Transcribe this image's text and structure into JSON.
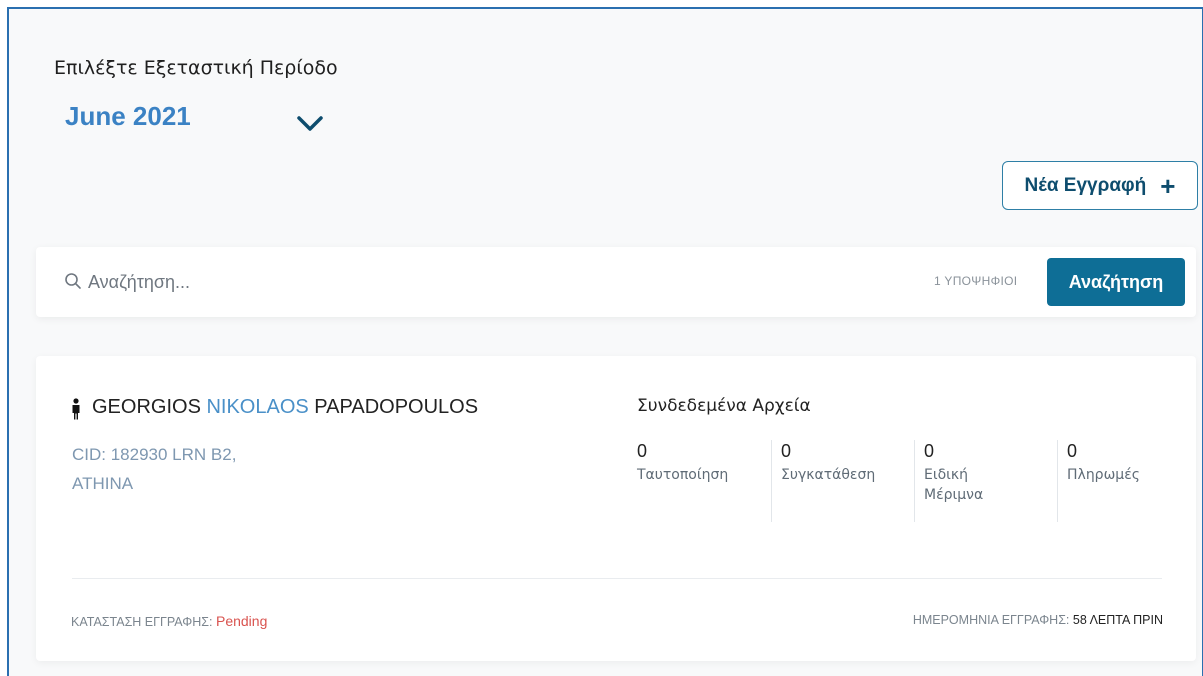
{
  "period": {
    "label": "Επιλέξτε Εξεταστική Περίοδο",
    "selected": "June 2021"
  },
  "new_registration_label": "Νέα Εγγραφή",
  "search": {
    "placeholder": "Αναζήτηση...",
    "candidates_count": "1 ΥΠΟΨΗΦΙΟΙ",
    "button_label": "Αναζήτηση"
  },
  "candidate": {
    "first_name": "GEORGIOS",
    "middle_name": "NIKOLAOS",
    "last_name": "PAPADOPOULOS",
    "cid_line": "CID: 182930 LRN B2,",
    "city": "ATHINA",
    "files_title": "Συνδεδεμένα Αρχεία",
    "files": [
      {
        "count": "0",
        "label": "Ταυτοποίηση"
      },
      {
        "count": "0",
        "label": "Συγκατάθεση"
      },
      {
        "count": "0",
        "label": "Ειδική Μέριμνα"
      },
      {
        "count": "0",
        "label": "Πληρωμές"
      }
    ],
    "status_label": "ΚΑΤΑΣΤΑΣΗ ΕΓΓΡΑΦΗΣ:",
    "status_value": "Pending",
    "date_label": "ΗΜΕΡΟΜΗΝΙΑ ΕΓΓΡΑΦΗΣ:",
    "date_value": "58 ΛΕΠΤΑ ΠΡΙΝ"
  },
  "colors": {
    "accent": "#0e6e96",
    "period_value": "#3b82c4",
    "status_pending": "#d9534f"
  }
}
